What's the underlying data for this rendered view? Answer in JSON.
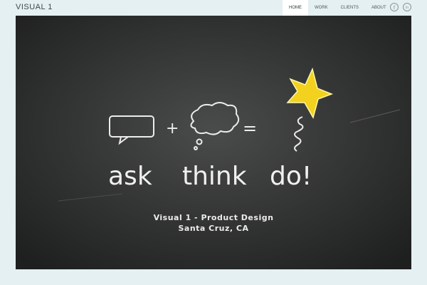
{
  "header": {
    "logo": "VISUAL 1",
    "nav": [
      "HOME",
      "WORK",
      "CLIENTS",
      "ABOUT"
    ],
    "active_nav": "HOME",
    "social": [
      {
        "icon": "facebook-icon",
        "glyph": "f"
      },
      {
        "icon": "linkedin-icon",
        "glyph": "in"
      }
    ]
  },
  "hero": {
    "words": [
      "ask",
      "think",
      "do!"
    ],
    "symbols": [
      "+",
      "="
    ],
    "caption_line1": "Visual 1 - Product Design",
    "caption_line2": "Santa Cruz, CA",
    "colors": {
      "chalkboard": "#2e302f",
      "star": "#f2d21e",
      "chalk": "#f0f0ee"
    }
  }
}
